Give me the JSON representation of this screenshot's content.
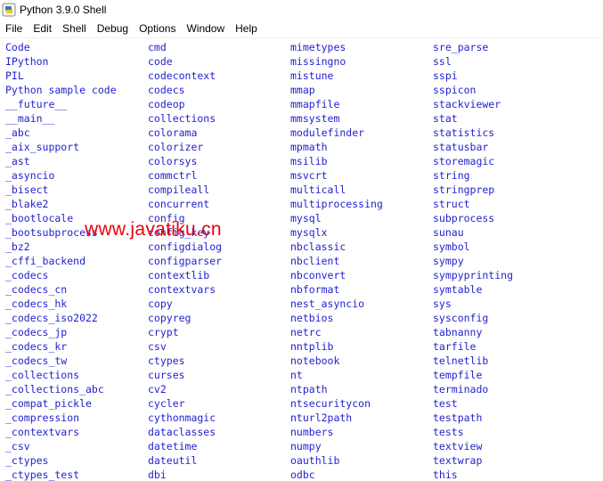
{
  "window": {
    "title": "Python 3.9.0 Shell"
  },
  "menu": [
    "File",
    "Edit",
    "Shell",
    "Debug",
    "Options",
    "Window",
    "Help"
  ],
  "modules": {
    "col1": [
      "Code",
      "IPython",
      "PIL",
      "Python sample code",
      "__future__",
      "__main__",
      "_abc",
      "_aix_support",
      "_ast",
      "_asyncio",
      "_bisect",
      "_blake2",
      "_bootlocale",
      "_bootsubprocess",
      "_bz2",
      "_cffi_backend",
      "_codecs",
      "_codecs_cn",
      "_codecs_hk",
      "_codecs_iso2022",
      "_codecs_jp",
      "_codecs_kr",
      "_codecs_tw",
      "_collections",
      "_collections_abc",
      "_compat_pickle",
      "_compression",
      "_contextvars",
      "_csv",
      "_ctypes",
      "_ctypes_test"
    ],
    "col2": [
      "cmd",
      "code",
      "codecontext",
      "codecs",
      "codeop",
      "collections",
      "colorama",
      "colorizer",
      "colorsys",
      "commctrl",
      "compileall",
      "concurrent",
      "config",
      "config_key",
      "configdialog",
      "configparser",
      "contextlib",
      "contextvars",
      "copy",
      "copyreg",
      "crypt",
      "csv",
      "ctypes",
      "curses",
      "cv2",
      "cycler",
      "cythonmagic",
      "dataclasses",
      "datetime",
      "dateutil",
      "dbi"
    ],
    "col3": [
      "mimetypes",
      "missingno",
      "mistune",
      "mmap",
      "mmapfile",
      "mmsystem",
      "modulefinder",
      "mpmath",
      "msilib",
      "msvcrt",
      "multicall",
      "multiprocessing",
      "mysql",
      "mysqlx",
      "nbclassic",
      "nbclient",
      "nbconvert",
      "nbformat",
      "nest_asyncio",
      "netbios",
      "netrc",
      "nntplib",
      "notebook",
      "nt",
      "ntpath",
      "ntsecuritycon",
      "nturl2path",
      "numbers",
      "numpy",
      "oauthlib",
      "odbc"
    ],
    "col4": [
      "sre_parse",
      "ssl",
      "sspi",
      "sspicon",
      "stackviewer",
      "stat",
      "statistics",
      "statusbar",
      "storemagic",
      "string",
      "stringprep",
      "struct",
      "subprocess",
      "sunau",
      "symbol",
      "sympy",
      "sympyprinting",
      "symtable",
      "sys",
      "sysconfig",
      "tabnanny",
      "tarfile",
      "telnetlib",
      "tempfile",
      "terminado",
      "test",
      "testpath",
      "tests",
      "textview",
      "textwrap",
      "this"
    ]
  },
  "watermark": "www.javatiku.cn",
  "colors": {
    "module_text": "#1f1fcf",
    "watermark": "#e8000a"
  }
}
